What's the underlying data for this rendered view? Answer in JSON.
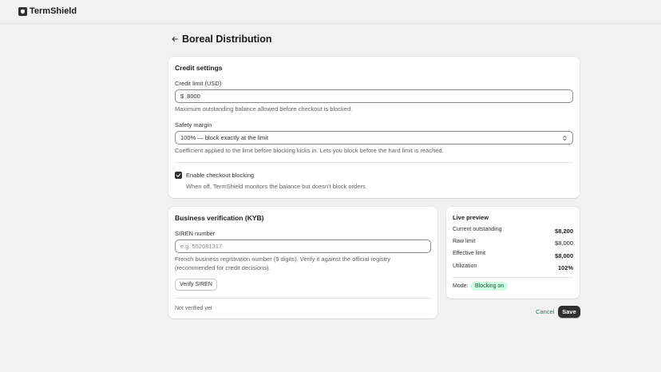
{
  "app": {
    "name": "TermShield",
    "logo_icon": "shield-icon"
  },
  "page": {
    "title": "Boreal Distribution",
    "back_icon": "arrow-left-icon"
  },
  "credit": {
    "section_title": "Credit settings",
    "limit_label": "Credit limit (USD)",
    "limit_prefix": "$",
    "limit_value": "8000",
    "limit_help": "Maximum outstanding balance allowed before checkout is blocked.",
    "margin_label": "Safety margin",
    "margin_selected": "100% — block exactly at the limit",
    "margin_help": "Coefficient applied to the limit before blocking kicks in. Lets you block before the hard limit is reached.",
    "blocking_label": "Enable checkout blocking",
    "blocking_checked": true,
    "blocking_help": "When off, TermShield monitors the balance but doesn't block orders."
  },
  "kyb": {
    "section_title": "Business verification (KYB)",
    "siren_label": "SIREN number",
    "siren_placeholder": "e.g. 552081317",
    "siren_help_1": "French business registration number (9 digits). Verify it against the official registry",
    "siren_help_2": "(recommended for credit decisions).",
    "verify_button": "Verify SIREN",
    "status": "Not verified yet"
  },
  "preview": {
    "title": "Live preview",
    "rows": [
      {
        "label": "Current outstanding",
        "value": "$8,200"
      },
      {
        "label": "Raw limit",
        "value": "$8,000"
      },
      {
        "label": "Effective limit",
        "value": "$8,000"
      },
      {
        "label": "Utilization",
        "value": "102%"
      }
    ],
    "mode_label": "Mode:",
    "mode_badge": "Blocking on"
  },
  "actions": {
    "cancel": "Cancel",
    "save": "Save"
  },
  "colors": {
    "background": "#f1f1f1",
    "card": "#ffffff",
    "primary_button": "#303030",
    "badge_bg": "#cdfee1",
    "badge_text": "#0c5132",
    "link": "#1a7a6b"
  }
}
